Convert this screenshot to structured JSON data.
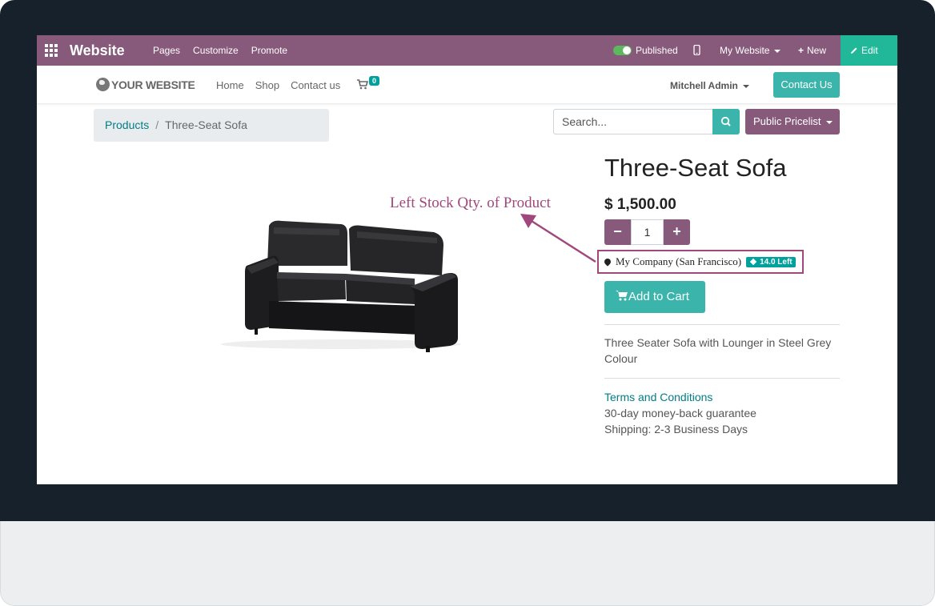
{
  "admin_bar": {
    "app_title": "Website",
    "menu": [
      "Pages",
      "Customize",
      "Promote"
    ],
    "published_label": "Published",
    "website_switcher": "My Website",
    "new_label": "New",
    "edit_label": "Edit",
    "published_state": true,
    "color": "#875a7b"
  },
  "header": {
    "logo_text": "YOUR WEBSITE",
    "nav": [
      "Home",
      "Shop",
      "Contact us"
    ],
    "cart_count": "0",
    "user_name": "Mitchell Admin",
    "contact_button": "Contact Us"
  },
  "breadcrumb": {
    "parent": "Products",
    "separator": "/",
    "current": "Three-Seat Sofa"
  },
  "search": {
    "placeholder": "Search..."
  },
  "pricelist": {
    "label": "Public Pricelist"
  },
  "annotation": {
    "label": "Left Stock Qty. of Product",
    "color": "#a0487c"
  },
  "product": {
    "name": "Three-Seat Sofa",
    "price": "$ 1,500.00",
    "quantity": "1",
    "warehouse": "My Company (San Francisco)",
    "stock_left": "14.0 Left",
    "add_to_cart": "Add to Cart",
    "description": "Three Seater Sofa with Lounger in Steel Grey Colour",
    "terms_link": "Terms and Conditions",
    "guarantee": "30-day money-back guarantee",
    "shipping": "Shipping: 2-3 Business Days"
  },
  "colors": {
    "accent": "#3bb5ab",
    "link": "#017e84",
    "edit": "#21b799"
  }
}
